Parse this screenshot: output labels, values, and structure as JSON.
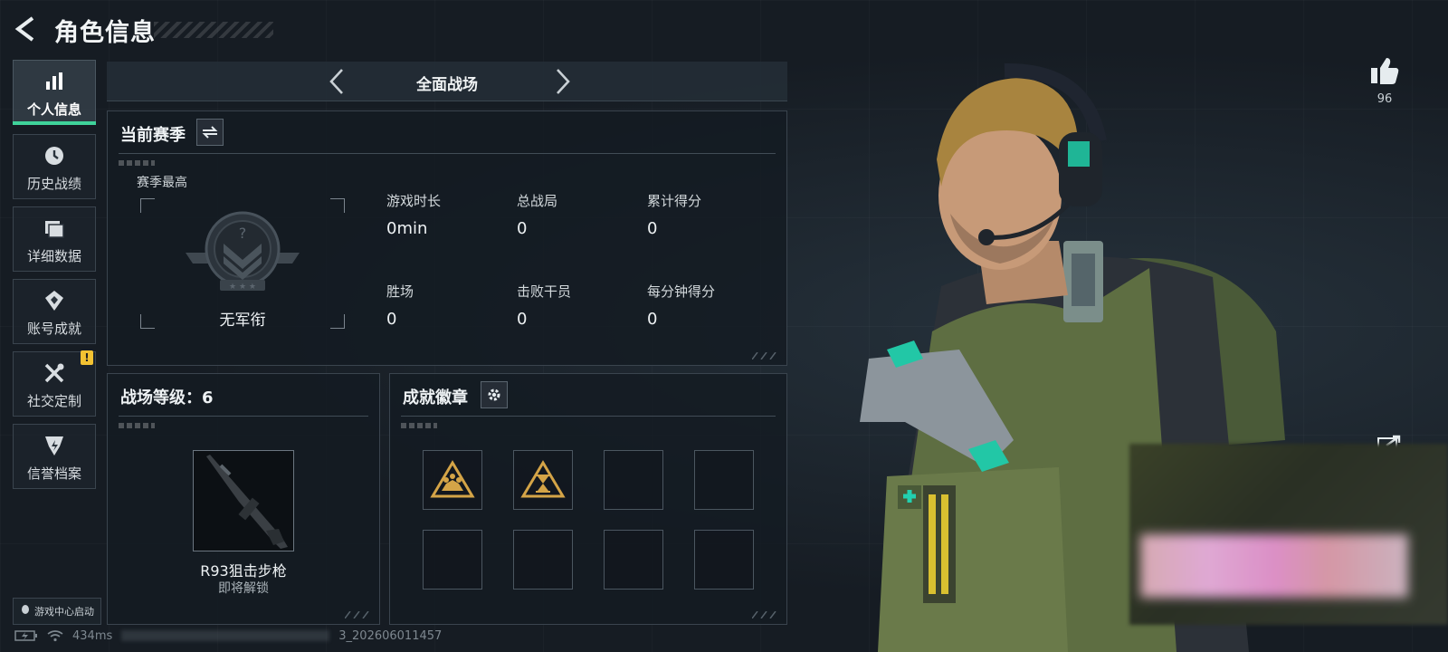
{
  "header": {
    "title": "角色信息"
  },
  "sidebar": {
    "items": [
      {
        "label": "个人信息",
        "icon": "bar-chart-icon",
        "active": true
      },
      {
        "label": "历史战绩",
        "icon": "history-icon"
      },
      {
        "label": "详细数据",
        "icon": "folder-icon"
      },
      {
        "label": "账号成就",
        "icon": "achievement-icon"
      },
      {
        "label": "社交定制",
        "icon": "tools-icon",
        "alert": "!"
      },
      {
        "label": "信誉档案",
        "icon": "credit-icon"
      }
    ],
    "game_center": "游戏中心启动"
  },
  "mode": {
    "label": "全面战场"
  },
  "season": {
    "title": "当前赛季",
    "best_label": "赛季最高",
    "rank_name": "无军衔",
    "stats": [
      {
        "key": "游戏时长",
        "value": "0min"
      },
      {
        "key": "总战局",
        "value": "0"
      },
      {
        "key": "累计得分",
        "value": "0"
      },
      {
        "key": "胜场",
        "value": "0"
      },
      {
        "key": "击败干员",
        "value": "0"
      },
      {
        "key": "每分钟得分",
        "value": "0"
      }
    ]
  },
  "level": {
    "title": "战场等级：6",
    "weapon_name": "R93狙击步枪",
    "weapon_sub": "即将解锁"
  },
  "badges": {
    "title": "成就徽章",
    "accent": "#d4a447"
  },
  "likes": {
    "count": "96"
  },
  "status": {
    "ping": "434ms",
    "build": "3_202606011457"
  },
  "colors": {
    "accent": "#3fd39a",
    "alert": "#f3c232"
  }
}
